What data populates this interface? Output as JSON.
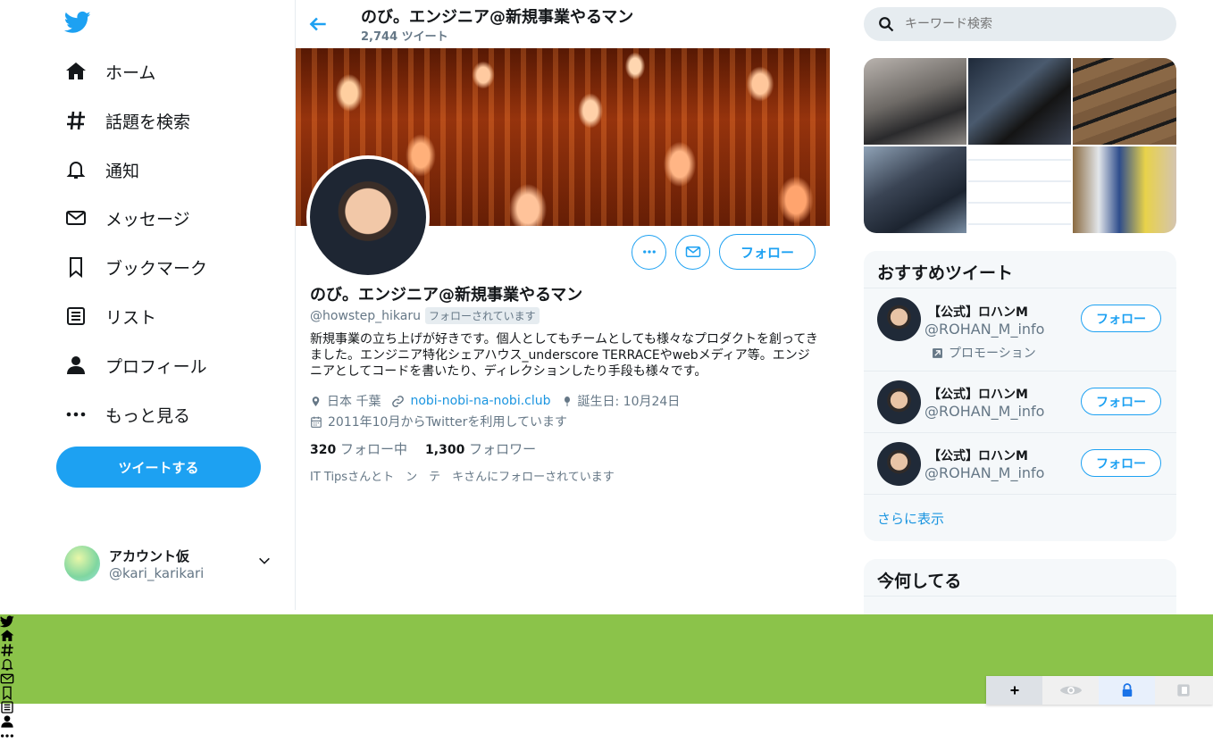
{
  "colors": {
    "accent": "#1da1f2",
    "link": "#1b95e0",
    "muted": "#657786",
    "green_bar": "#8bc34a"
  },
  "sidebar": {
    "logo_icon": "twitter-bird-icon",
    "items": [
      {
        "label": "ホーム",
        "icon": "home-icon"
      },
      {
        "label": "話題を検索",
        "icon": "hashtag-icon"
      },
      {
        "label": "通知",
        "icon": "bell-icon"
      },
      {
        "label": "メッセージ",
        "icon": "envelope-icon"
      },
      {
        "label": "ブックマーク",
        "icon": "bookmark-icon"
      },
      {
        "label": "リスト",
        "icon": "list-icon"
      },
      {
        "label": "プロフィール",
        "icon": "person-icon"
      },
      {
        "label": "もっと見る",
        "icon": "more-icon"
      }
    ],
    "tweet_button": "ツイートする",
    "account": {
      "name": "アカウント仮",
      "handle": "@kari_karikari"
    }
  },
  "header": {
    "title": "のび。エンジニア@新規事業やるマン",
    "tweet_count": "2,744 ツイート"
  },
  "profile": {
    "name": "のび。エンジニア@新規事業やるマン",
    "handle": "@howstep_hikaru",
    "follows_you": "フォローされています",
    "bio": "新規事業の立ち上げが好きです。個人としてもチームとしても様々なプロダクトを創ってきました。エンジニア特化シェアハウス_underscore TERRACEやwebメディア等。エンジニアとしてコードを書いたり、ディレクションしたり手段も様々です。",
    "location": "日本 千葉",
    "url": "nobi-nobi-na-nobi.club",
    "birthday": "誕生日: 10月24日",
    "joined": "2011年10月からTwitterを利用しています",
    "following_count": "320",
    "following_label": "フォロー中",
    "followers_count": "1,300",
    "followers_label": "フォロワー",
    "followed_by": "IT Tipsさんとト　ン　テ　キさんにフォローされています",
    "follow_button": "フォロー"
  },
  "right": {
    "search_placeholder": "キーワード検索",
    "recommended": {
      "title": "おすすめツイート",
      "items": [
        {
          "name": "【公式】ロハンM",
          "handle": "@ROHAN_M_info",
          "promo": "プロモーション",
          "button": "フォロー"
        },
        {
          "name": "【公式】ロハンM",
          "handle": "@ROHAN_M_info",
          "button": "フォロー"
        },
        {
          "name": "【公式】ロハンM",
          "handle": "@ROHAN_M_info",
          "button": "フォロー"
        }
      ],
      "more": "さらに表示"
    },
    "whats_happening": "今何してる"
  }
}
